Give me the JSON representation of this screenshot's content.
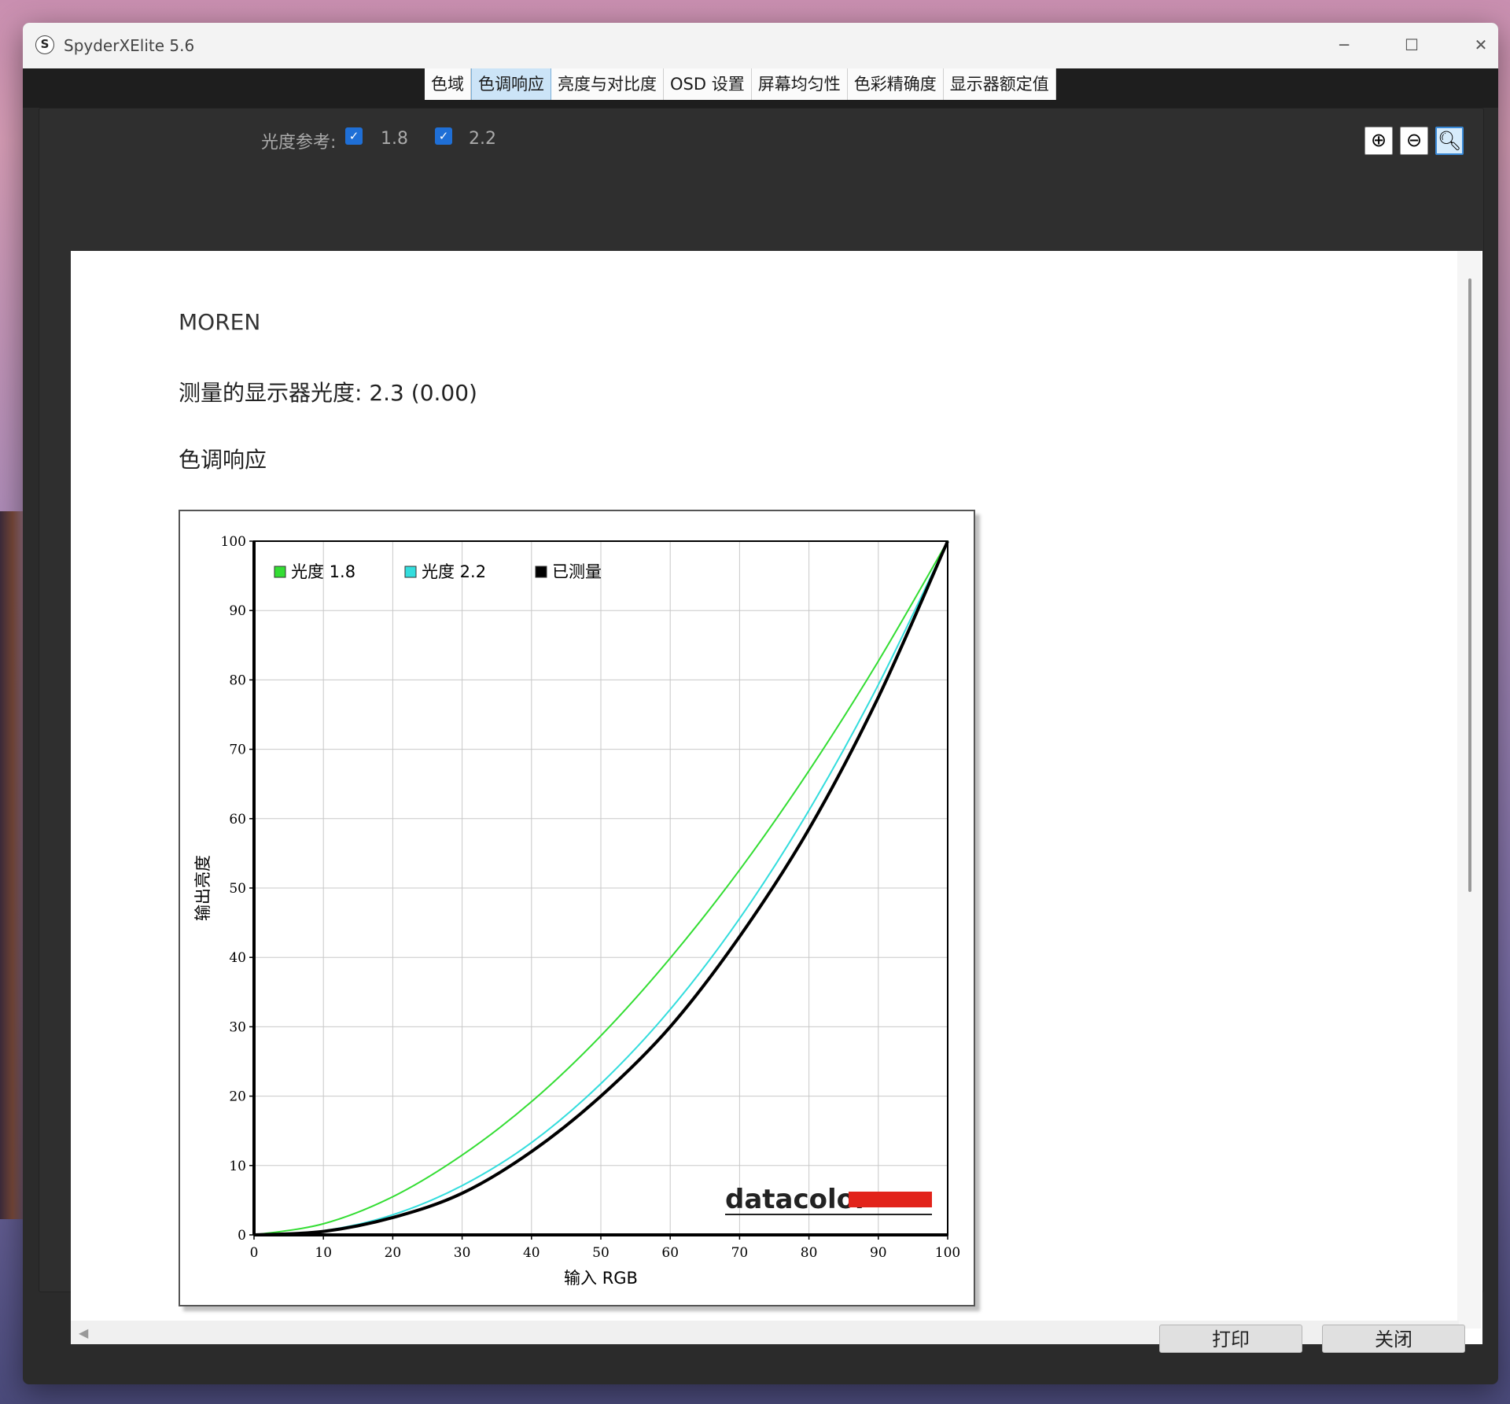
{
  "window": {
    "title": "SpyderXElite 5.6",
    "icon_letter": "S",
    "minimize": "─",
    "maximize": "☐",
    "close": "✕"
  },
  "tabs": [
    {
      "label": "色域"
    },
    {
      "label": "色调响应"
    },
    {
      "label": "亮度与对比度"
    },
    {
      "label": "OSD 设置"
    },
    {
      "label": "屏幕均匀性"
    },
    {
      "label": "色彩精确度"
    },
    {
      "label": "显示器额定值"
    }
  ],
  "active_tab": 1,
  "toolbar": {
    "gamma_ref_label": "光度参考:",
    "ref1_label": "1.8",
    "ref1_checked": true,
    "ref2_label": "2.2",
    "ref2_checked": true
  },
  "report": {
    "profile_name": "MOREN",
    "measured_label": "测量的显示器光度:",
    "measured_value": "2.3 (0.00)",
    "section_title": "色调响应"
  },
  "chart_data": {
    "type": "line",
    "xlabel": "输入 RGB",
    "ylabel": "输出亮度",
    "xlim": [
      0,
      100
    ],
    "ylim": [
      0,
      100
    ],
    "ticks": [
      0,
      10,
      20,
      30,
      40,
      50,
      60,
      70,
      80,
      90,
      100
    ],
    "grid": true,
    "legend_position": "top-left",
    "x": [
      0,
      10,
      20,
      30,
      40,
      50,
      60,
      70,
      80,
      90,
      100
    ],
    "series": [
      {
        "name": "光度 1.8",
        "color": "#33dd33",
        "values": [
          0,
          1.6,
          5.5,
          11.5,
          19.2,
          28.7,
          39.9,
          52.6,
          66.9,
          82.7,
          100
        ]
      },
      {
        "name": "光度 2.2",
        "color": "#33dddd",
        "values": [
          0,
          0.6,
          2.9,
          7.1,
          13.3,
          21.8,
          32.5,
          45.6,
          61.2,
          79.3,
          100
        ]
      },
      {
        "name": "已测量",
        "color": "#000000",
        "values": [
          0,
          0.5,
          2.5,
          6.0,
          12.0,
          20.0,
          30.0,
          43.0,
          58.5,
          77.5,
          100
        ]
      }
    ],
    "watermark": "datacolor"
  },
  "footer": {
    "print_label": "打印",
    "close_label": "关闭"
  }
}
